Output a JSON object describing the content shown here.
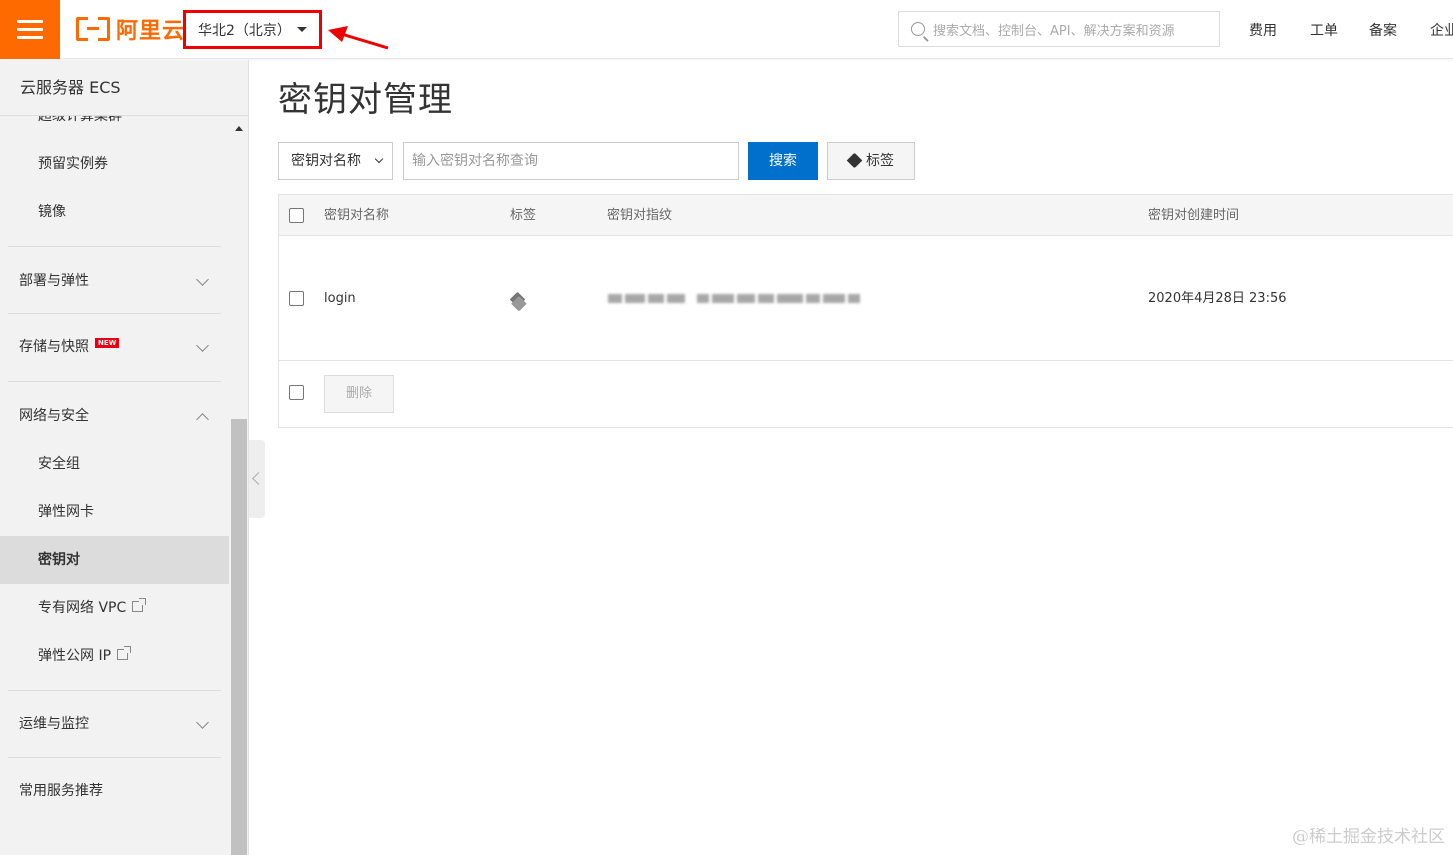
{
  "header": {
    "logo_text": "阿里云",
    "region": "华北2（北京）",
    "search_placeholder": "搜索文档、控制台、API、解决方案和资源",
    "nav": [
      "费用",
      "工单",
      "备案",
      "企业"
    ]
  },
  "sidebar": {
    "title": "云服务器 ECS",
    "items": [
      {
        "label": "超级计算集群",
        "type": "sub"
      },
      {
        "label": "预留实例券",
        "type": "sub"
      },
      {
        "label": "镜像",
        "type": "sub"
      },
      {
        "label": "部署与弹性",
        "type": "group",
        "state": "collapsed"
      },
      {
        "label": "存储与快照",
        "type": "group",
        "state": "collapsed",
        "badge": "NEW"
      },
      {
        "label": "网络与安全",
        "type": "group",
        "state": "expanded"
      },
      {
        "label": "安全组",
        "type": "sub"
      },
      {
        "label": "弹性网卡",
        "type": "sub"
      },
      {
        "label": "密钥对",
        "type": "sub",
        "active": true
      },
      {
        "label": "专有网络 VPC",
        "type": "sub",
        "external": true
      },
      {
        "label": "弹性公网 IP",
        "type": "sub",
        "external": true
      },
      {
        "label": "运维与监控",
        "type": "group",
        "state": "collapsed"
      },
      {
        "label": "常用服务推荐",
        "type": "group"
      }
    ]
  },
  "main": {
    "title": "密钥对管理",
    "filter_field": "密钥对名称",
    "filter_placeholder": "输入密钥对名称查询",
    "search_button": "搜索",
    "tag_button": "标签",
    "columns": [
      "密钥对名称",
      "标签",
      "密钥对指纹",
      "密钥对创建时间"
    ],
    "rows": [
      {
        "name": "login",
        "created": "2020年4月28日 23:56"
      }
    ],
    "delete_button": "删除"
  },
  "watermark": "@稀土掘金技术社区",
  "colors": {
    "brand": "#ff6a00",
    "primary_button": "#0070cc",
    "highlight_box": "#ee0000"
  }
}
